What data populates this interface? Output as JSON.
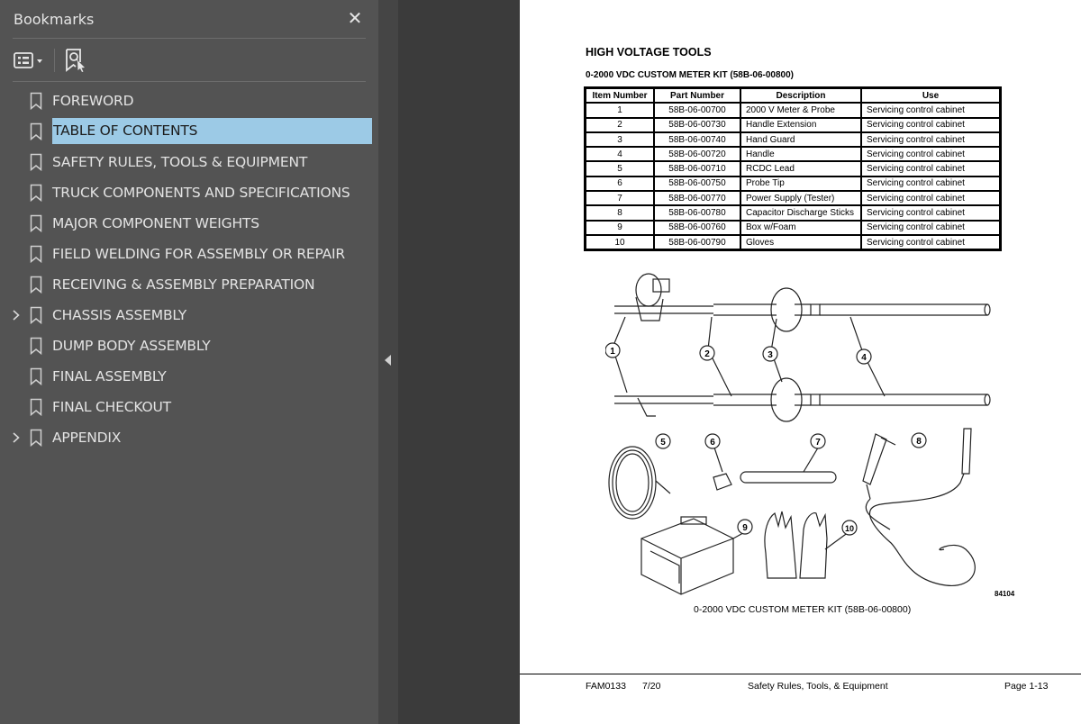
{
  "sidebar": {
    "title": "Bookmarks",
    "close_label": "✕",
    "items": [
      {
        "label": "FOREWORD"
      },
      {
        "label": "TABLE OF CONTENTS"
      },
      {
        "label": "SAFETY RULES, TOOLS & EQUIPMENT"
      },
      {
        "label": "TRUCK COMPONENTS AND SPECIFICATIONS"
      },
      {
        "label": "MAJOR COMPONENT WEIGHTS"
      },
      {
        "label": "FIELD WELDING FOR ASSEMBLY OR REPAIR"
      },
      {
        "label": "RECEIVING & ASSEMBLY PREPARATION"
      },
      {
        "label": "CHASSIS ASSEMBLY"
      },
      {
        "label": "DUMP BODY ASSEMBLY"
      },
      {
        "label": "FINAL ASSEMBLY"
      },
      {
        "label": "FINAL CHECKOUT"
      },
      {
        "label": "APPENDIX"
      }
    ],
    "selected_item": "TABLE OF CONTENTS",
    "expandable_items": [
      "CHASSIS ASSEMBLY",
      "APPENDIX"
    ],
    "selected_color": "#9ccae6"
  },
  "document": {
    "title": "HIGH VOLTAGE TOOLS",
    "subtitle": "0-2000 VDC CUSTOM METER KIT (58B-06-00800)",
    "table": {
      "headers": [
        "Item Number",
        "Part Number",
        "Description",
        "Use"
      ],
      "rows": [
        [
          "1",
          "58B-06-00700",
          "2000 V Meter & Probe",
          "Servicing control cabinet"
        ],
        [
          "2",
          "58B-06-00730",
          "Handle Extension",
          "Servicing control cabinet"
        ],
        [
          "3",
          "58B-06-00740",
          "Hand Guard",
          "Servicing control cabinet"
        ],
        [
          "4",
          "58B-06-00720",
          "Handle",
          "Servicing control cabinet"
        ],
        [
          "5",
          "58B-06-00710",
          "RCDC Lead",
          "Servicing control cabinet"
        ],
        [
          "6",
          "58B-06-00750",
          "Probe Tip",
          "Servicing control cabinet"
        ],
        [
          "7",
          "58B-06-00770",
          "Power Supply (Tester)",
          "Servicing control cabinet"
        ],
        [
          "8",
          "58B-06-00780",
          "Capacitor Discharge Sticks",
          "Servicing control cabinet"
        ],
        [
          "9",
          "58B-06-00760",
          "Box w/Foam",
          "Servicing control cabinet"
        ],
        [
          "10",
          "58B-06-00790",
          "Gloves",
          "Servicing control cabinet"
        ]
      ]
    },
    "figure": {
      "callouts": [
        "1",
        "2",
        "3",
        "4",
        "5",
        "6",
        "7",
        "8",
        "9",
        "10"
      ],
      "code": "84104",
      "caption": "0-2000 VDC CUSTOM METER KIT (58B-06-00800)"
    },
    "footer": {
      "doc_id": "FAM0133",
      "date": "7/20",
      "section": "Safety Rules, Tools, & Equipment",
      "page": "Page 1-13"
    }
  }
}
